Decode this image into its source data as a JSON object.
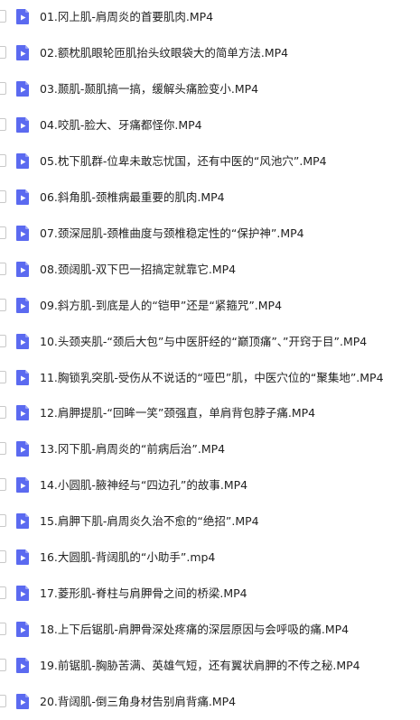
{
  "files": [
    {
      "name": "01.冈上肌-肩周炎的首要肌肉.MP4"
    },
    {
      "name": "02.额枕肌眼轮匝肌抬头纹眼袋大的简单方法.MP4"
    },
    {
      "name": "03.颞肌-颞肌搞一搞，缓解头痛脸变小.MP4"
    },
    {
      "name": "04.咬肌-脸大、牙痛都怪你.MP4"
    },
    {
      "name": "05.枕下肌群-位卑未敢忘忧国，还有中医的“风池穴”.MP4"
    },
    {
      "name": "06.斜角肌-颈椎病最重要的肌肉.MP4"
    },
    {
      "name": "07.颈深屈肌-颈椎曲度与颈椎稳定性的“保护神”.MP4"
    },
    {
      "name": "08.颈阔肌-双下巴一招搞定就靠它.MP4"
    },
    {
      "name": "09.斜方肌-到底是人的“铠甲”还是“紧箍咒”.MP4"
    },
    {
      "name": "10.头颈夹肌-“颈后大包”与中医肝经的“巅顶痛”、”开窍于目”.MP4"
    },
    {
      "name": "11.胸锁乳突肌-受伤从不说话的“哑巴”肌，中医穴位的“聚集地”.MP4"
    },
    {
      "name": "12.肩胛提肌-“回眸一笑”颈强直，单肩背包脖子痛.MP4"
    },
    {
      "name": "13.冈下肌-肩周炎的“前病后治”.MP4"
    },
    {
      "name": "14.小圆肌-腋神经与“四边孔”的故事.MP4"
    },
    {
      "name": "15.肩胛下肌-肩周炎久治不愈的“绝招”.MP4"
    },
    {
      "name": "16.大圆肌-背阔肌的“小助手”.mp4"
    },
    {
      "name": "17.菱形肌-脊柱与肩胛骨之间的桥梁.MP4"
    },
    {
      "name": "18.上下后锯肌-肩胛骨深处疼痛的深层原因与会呼吸的痛.MP4"
    },
    {
      "name": "19.前锯肌-胸胁苦满、英雄气短，还有翼状肩胛的不传之秘.MP4"
    },
    {
      "name": "20.背阔肌-倒三角身材告别肩背痛.MP4"
    }
  ],
  "icon": "video-file-icon",
  "colors": {
    "icon_fill": "#5b6af0",
    "icon_fold": "#9aa3f6",
    "text": "#222222",
    "checkbox_border": "#c9c9c9"
  }
}
